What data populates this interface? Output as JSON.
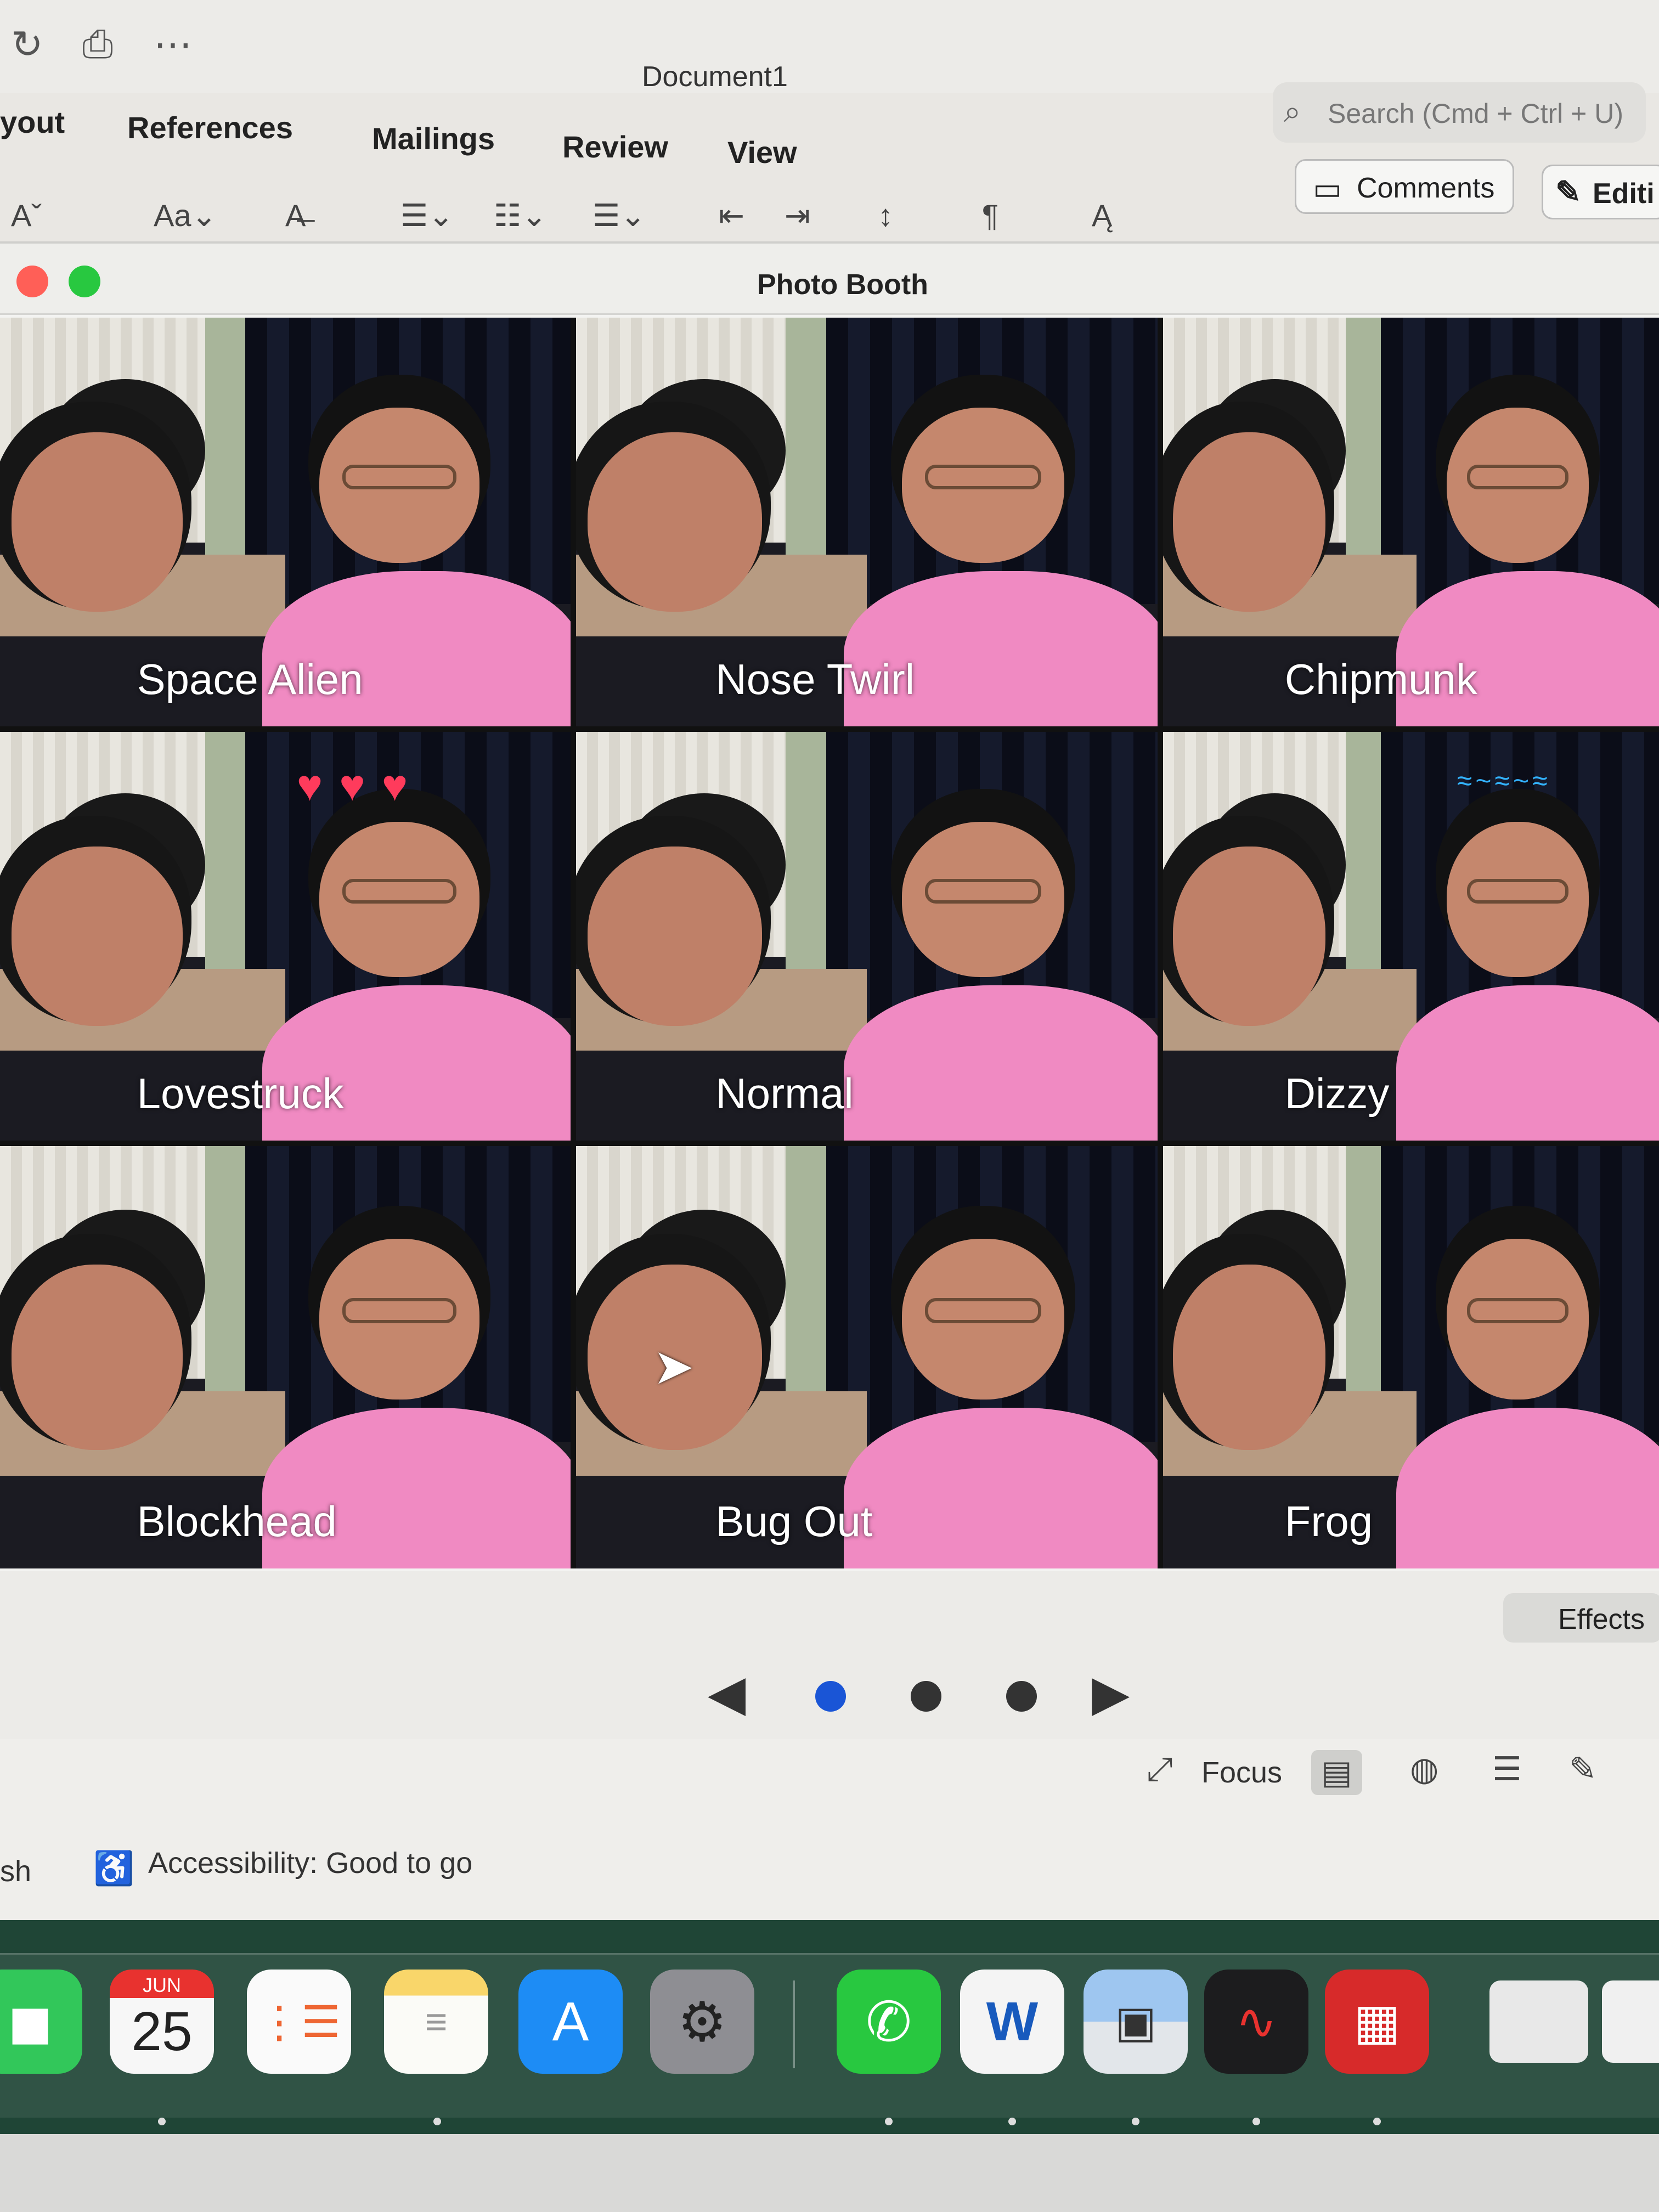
{
  "word": {
    "doc_title": "Document1",
    "tabs": [
      "yout",
      "References",
      "Mailings",
      "Review",
      "View"
    ],
    "search_placeholder": "Search (Cmd + Ctrl + U)",
    "comments_label": "Comments",
    "editing_label": "Editi",
    "status": {
      "left_text": "sh",
      "accessibility": "Accessibility: Good to go",
      "focus": "Focus"
    }
  },
  "photo_booth": {
    "title": "Photo Booth",
    "effects_label": "Effects",
    "page_count": 3,
    "current_page": 1,
    "tiles": [
      {
        "label": "Space Alien"
      },
      {
        "label": "Nose Twirl"
      },
      {
        "label": "Chipmunk"
      },
      {
        "label": "Lovestruck",
        "decor": "hearts"
      },
      {
        "label": "Normal"
      },
      {
        "label": "Dizzy",
        "decor": "birds"
      },
      {
        "label": "Blockhead"
      },
      {
        "label": "Bug Out"
      },
      {
        "label": "Frog"
      }
    ]
  },
  "dock": {
    "calendar_month": "JUN",
    "calendar_day": "25",
    "apps": [
      "facetime-icon",
      "calendar-icon",
      "reminders-icon",
      "notes-icon",
      "app-store-icon",
      "system-settings-icon",
      "whatsapp-icon",
      "word-icon",
      "preview-icon",
      "voice-memos-icon",
      "photo-booth-icon"
    ]
  },
  "colors": {
    "accent_blue": "#1a55d6",
    "dock_green": "#1f4536",
    "traffic_red": "#ff5f57",
    "traffic_green": "#28c840"
  }
}
